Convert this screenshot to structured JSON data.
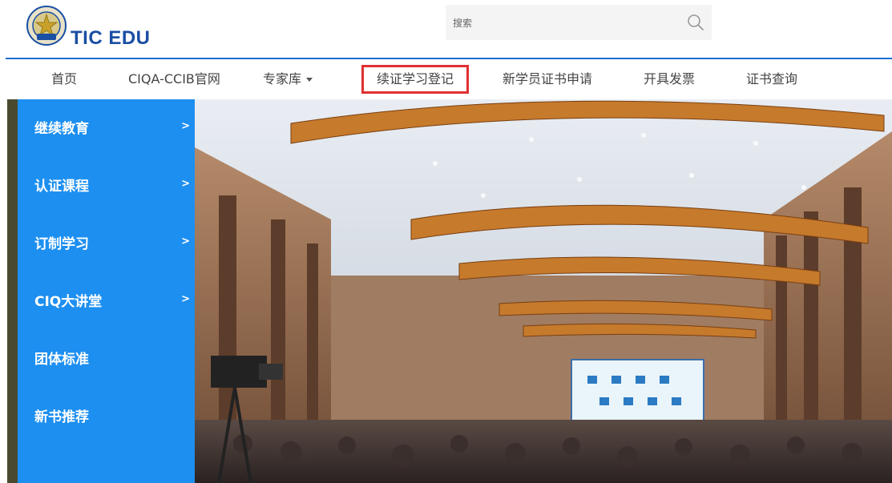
{
  "brand": {
    "name": "TIC EDU"
  },
  "search": {
    "placeholder": "搜索",
    "icon": "search-icon"
  },
  "nav": {
    "items": [
      {
        "label": "首页"
      },
      {
        "label": "CIQA-CCIB官网"
      },
      {
        "label": "专家库",
        "has_dropdown": true
      },
      {
        "label": "续证学习登记",
        "highlighted": true
      },
      {
        "label": "新学员证书申请"
      },
      {
        "label": "开具发票"
      },
      {
        "label": "证书查询"
      }
    ]
  },
  "sidebar": {
    "items": [
      {
        "label": "继续教育",
        "has_arrow": true
      },
      {
        "label": "认证课程",
        "has_arrow": true
      },
      {
        "label": "订制学习",
        "has_arrow": true
      },
      {
        "label": "CIQ大讲堂",
        "has_arrow": true
      },
      {
        "label": "团体标准",
        "has_arrow": false
      },
      {
        "label": "新书推荐",
        "has_arrow": false
      }
    ],
    "arrow_glyph": ">"
  },
  "colors": {
    "accent": "#1e6fd1",
    "sidebar": "#1d8ff0",
    "highlight_border": "#e03030"
  }
}
